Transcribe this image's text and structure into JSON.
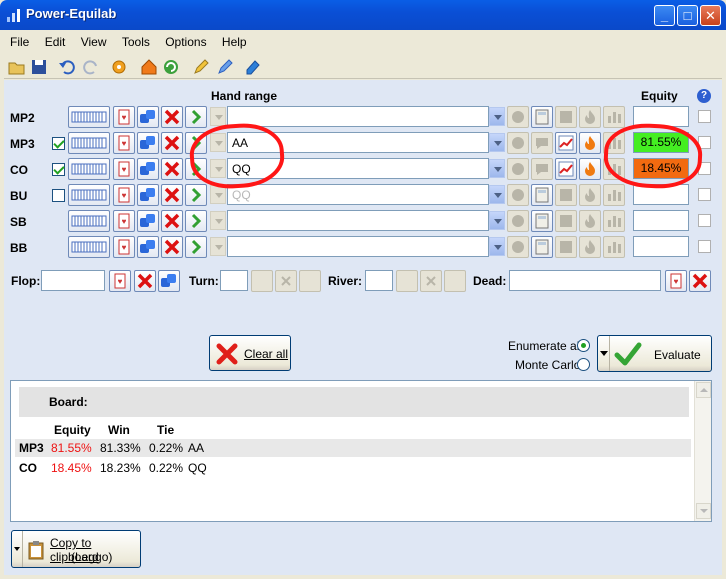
{
  "window": {
    "title": "Power-Equilab"
  },
  "menu": [
    "File",
    "Edit",
    "View",
    "Tools",
    "Options",
    "Help"
  ],
  "columns": {
    "hand_range": "Hand range",
    "equity": "Equity"
  },
  "players": [
    {
      "pos": "MP2",
      "checkbox": false,
      "show_check": false,
      "range": "",
      "range_ghost": "",
      "equity": "",
      "equity_color": ""
    },
    {
      "pos": "MP3",
      "checkbox": true,
      "show_check": true,
      "range": "AA",
      "range_ghost": "",
      "equity": "81.55%",
      "equity_color": "#44ee22"
    },
    {
      "pos": "CO",
      "checkbox": true,
      "show_check": true,
      "range": "QQ",
      "range_ghost": "",
      "equity": "18.45%",
      "equity_color": "#f26a10"
    },
    {
      "pos": "BU",
      "checkbox": false,
      "show_check": true,
      "range": "",
      "range_ghost": "QQ",
      "equity": "",
      "equity_color": ""
    },
    {
      "pos": "SB",
      "checkbox": false,
      "show_check": false,
      "range": "",
      "range_ghost": "",
      "equity": "",
      "equity_color": ""
    },
    {
      "pos": "BB",
      "checkbox": false,
      "show_check": false,
      "range": "",
      "range_ghost": "",
      "equity": "",
      "equity_color": ""
    }
  ],
  "board": {
    "flop": "Flop:",
    "turn": "Turn:",
    "river": "River:",
    "dead": "Dead:"
  },
  "actions": {
    "clear_all": "Clear all",
    "enumerate_all": "Enumerate all",
    "monte_carlo": "Monte Carlo",
    "evaluate": "Evaluate",
    "copy_line1": "Copy to clipboard",
    "copy_line2": "(Leggo)"
  },
  "results": {
    "board_label": "Board:",
    "headers": [
      "Equity",
      "Win",
      "Tie"
    ],
    "rows": [
      {
        "pos": "MP3",
        "equity": "81.55%",
        "win": "81.33%",
        "tie": "0.22%",
        "hand": "AA"
      },
      {
        "pos": "CO",
        "equity": "18.45%",
        "win": "18.23%",
        "tie": "0.22%",
        "hand": "QQ"
      }
    ]
  },
  "colors": {
    "titlebar": "#0a5ee6",
    "client": "#dfe7f4",
    "annotation_red": "#ff1616",
    "equity_text_red": "#ee1111"
  }
}
